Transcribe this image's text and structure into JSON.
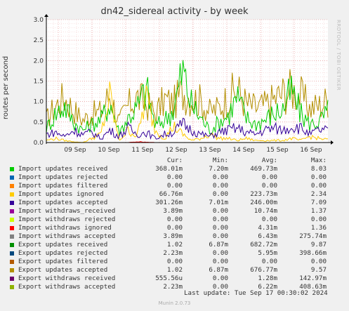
{
  "title": "dn42_sidereal activity - by week",
  "watermark": "RRDTOOL / TOBI OETIKER",
  "ylabel": "routes per second",
  "headers": {
    "cur": "Cur:",
    "min": "Min:",
    "avg": "Avg:",
    "max": "Max:"
  },
  "legend": [
    {
      "name": "Import updates received",
      "color": "#00cc00",
      "cur": "368.01m",
      "min": "7.20m",
      "avg": "469.73m",
      "max": "8.03"
    },
    {
      "name": "Import updates rejected",
      "color": "#0066b3",
      "cur": "0.00",
      "min": "0.00",
      "avg": "0.00",
      "max": "0.00"
    },
    {
      "name": "Import updates filtered",
      "color": "#ff8000",
      "cur": "0.00",
      "min": "0.00",
      "avg": "0.00",
      "max": "0.00"
    },
    {
      "name": "Import updates ignored",
      "color": "#ffcc00",
      "cur": "66.76m",
      "min": "0.00",
      "avg": "223.73m",
      "max": "2.34"
    },
    {
      "name": "Import updates accepted",
      "color": "#330099",
      "cur": "301.26m",
      "min": "7.01m",
      "avg": "246.00m",
      "max": "7.09"
    },
    {
      "name": "Import withdraws_received",
      "color": "#990099",
      "cur": "3.89m",
      "min": "0.00",
      "avg": "10.74m",
      "max": "1.37"
    },
    {
      "name": "Import withdraws rejected",
      "color": "#ccff00",
      "cur": "0.00",
      "min": "0.00",
      "avg": "0.00",
      "max": "0.00"
    },
    {
      "name": "Import withdraws ignored",
      "color": "#ff0000",
      "cur": "0.00",
      "min": "0.00",
      "avg": "4.31m",
      "max": "1.36"
    },
    {
      "name": "Import withdraws accepted",
      "color": "#808080",
      "cur": "3.89m",
      "min": "0.00",
      "avg": "6.43m",
      "max": "275.74m"
    },
    {
      "name": "Export updates received",
      "color": "#008f00",
      "cur": "1.02",
      "min": "6.87m",
      "avg": "682.72m",
      "max": "9.87"
    },
    {
      "name": "Export updates rejected",
      "color": "#00487d",
      "cur": "2.23m",
      "min": "0.00",
      "avg": "5.95m",
      "max": "398.66m"
    },
    {
      "name": "Export updates filtered",
      "color": "#b35a00",
      "cur": "0.00",
      "min": "0.00",
      "avg": "0.00",
      "max": "0.00"
    },
    {
      "name": "Export updates accepted",
      "color": "#b38f00",
      "cur": "1.02",
      "min": "6.87m",
      "avg": "676.77m",
      "max": "9.57"
    },
    {
      "name": "Export withdraws received",
      "color": "#6b006b",
      "cur": "555.56u",
      "min": "0.00",
      "avg": "1.28m",
      "max": "142.97m"
    },
    {
      "name": "Export withdraws accepted",
      "color": "#8fb300",
      "cur": "2.23m",
      "min": "0.00",
      "avg": "6.22m",
      "max": "408.63m"
    }
  ],
  "last_update": "Last update: Tue Sep 17 00:30:02 2024",
  "footer": "Munin 2.0.73",
  "chart_data": {
    "type": "line",
    "title": "dn42_sidereal activity - by week",
    "ylabel": "routes per second",
    "xlabel": "",
    "ylim": [
      0,
      3.0
    ],
    "yticks": [
      "0.0",
      "0.5",
      "1.0",
      "1.5",
      "2.0",
      "2.5",
      "3.0"
    ],
    "x": [
      "09 Sep",
      "10 Sep",
      "11 Sep",
      "12 Sep",
      "13 Sep",
      "14 Sep",
      "15 Sep",
      "16 Sep"
    ],
    "grid": true,
    "series": [
      {
        "name": "Export updates accepted",
        "color": "#b38f00",
        "values": [
          0.55,
          0.9,
          1.1,
          0.8,
          0.55,
          0.7,
          0.75,
          1.2,
          0.5,
          0.9,
          1.1,
          0.95,
          0.7,
          1.05,
          0.95,
          1.25,
          1.1,
          1.0,
          0.75,
          0.85,
          1.1,
          1.3,
          0.95,
          0.85,
          0.9,
          1.05,
          1.2,
          1.3,
          1.15,
          0.85,
          0.9,
          1.05
        ]
      },
      {
        "name": "Import updates received",
        "color": "#00cc00",
        "values": [
          0.35,
          0.7,
          0.9,
          0.5,
          0.3,
          0.45,
          0.55,
          1.0,
          0.25,
          0.6,
          0.85,
          1.3,
          0.4,
          0.55,
          0.8,
          1.75,
          0.9,
          0.6,
          0.3,
          0.5,
          0.65,
          1.1,
          0.6,
          0.45,
          0.55,
          0.7,
          0.8,
          1.25,
          0.7,
          0.45,
          0.5,
          0.75
        ]
      },
      {
        "name": "Import updates ignored",
        "color": "#ffcc00",
        "values": [
          0.05,
          0.1,
          0.05,
          0.02,
          0.0,
          0.1,
          0.2,
          1.1,
          0.05,
          0.3,
          0.15,
          1.1,
          0.3,
          0.1,
          0.4,
          0.2,
          0.05,
          0.1,
          0.2,
          0.1,
          0.1,
          0.05,
          0.1,
          0.05,
          0.05,
          0.05,
          0.05,
          0.1,
          0.05,
          0.15,
          0.1,
          0.07
        ]
      },
      {
        "name": "Import updates accepted",
        "color": "#330099",
        "values": [
          0.2,
          0.25,
          0.15,
          0.3,
          0.2,
          0.25,
          0.1,
          0.3,
          0.15,
          0.35,
          0.2,
          0.25,
          0.1,
          0.2,
          0.25,
          0.45,
          0.3,
          0.2,
          0.15,
          0.25,
          0.3,
          0.35,
          0.25,
          0.2,
          0.3,
          0.35,
          0.3,
          0.4,
          0.35,
          0.2,
          0.3,
          0.3
        ]
      },
      {
        "name": "Import withdraws ignored",
        "color": "#ff0000",
        "values": [
          0,
          0,
          0,
          0,
          0,
          0,
          0,
          0,
          0,
          0,
          0.02,
          0.01,
          0,
          0,
          0,
          0,
          0,
          0,
          0,
          0,
          0,
          0,
          0,
          0,
          0,
          0,
          0,
          0,
          0,
          0,
          0,
          0
        ]
      }
    ]
  }
}
